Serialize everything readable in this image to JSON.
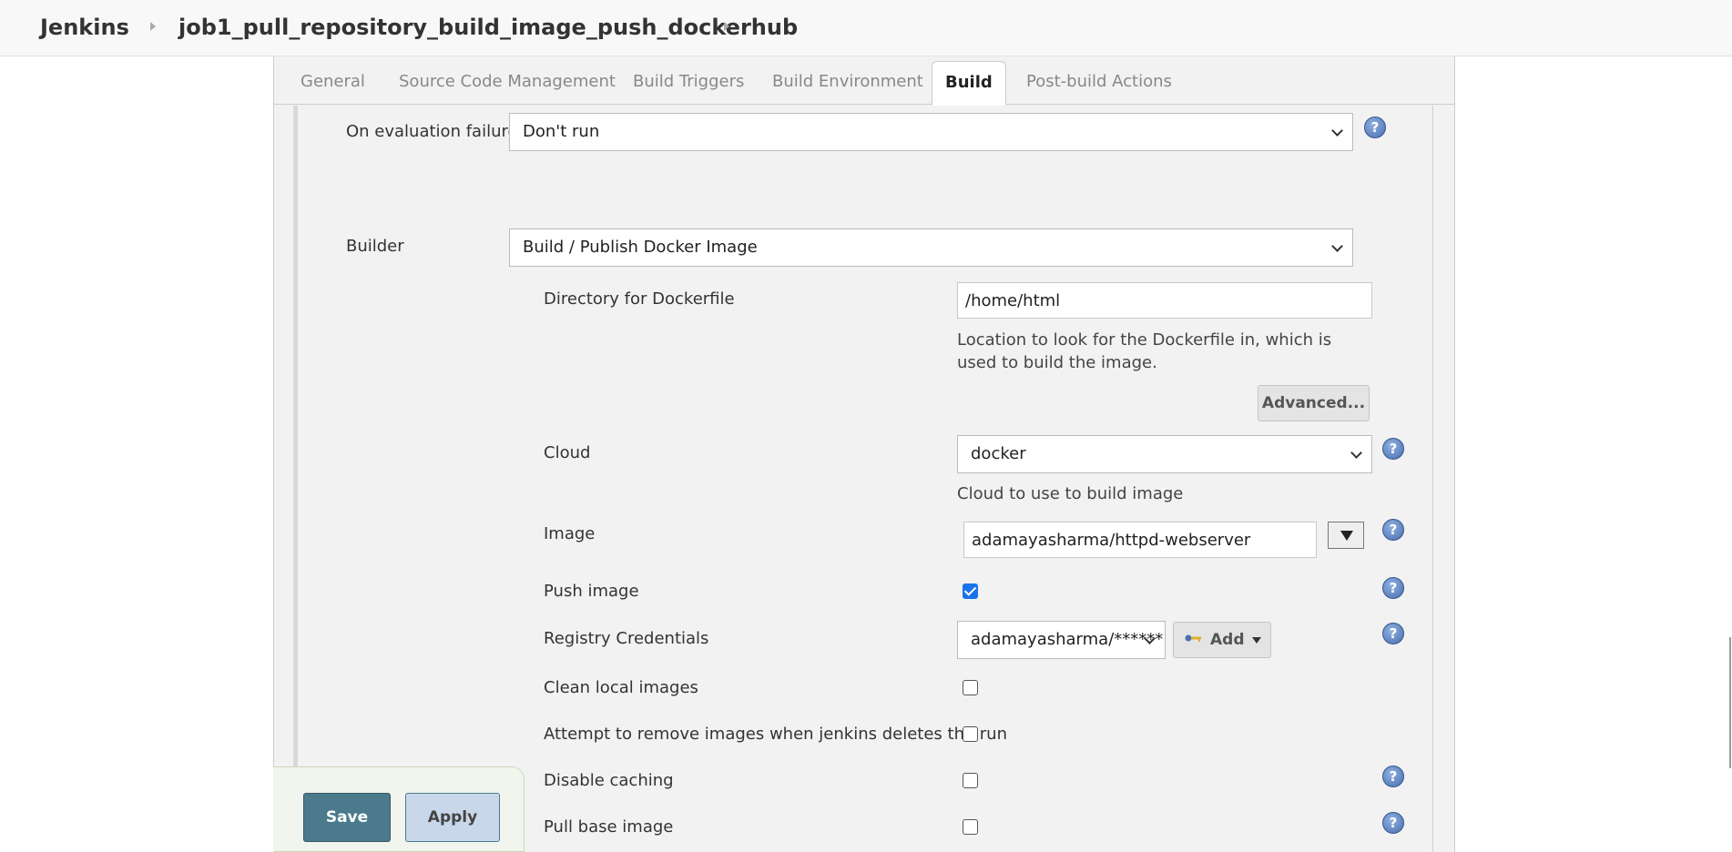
{
  "breadcrumb": {
    "root": "Jenkins",
    "job": "job1_pull_repository_build_image_push_dockerhub"
  },
  "tabs": [
    {
      "label": "General"
    },
    {
      "label": "Source Code Management"
    },
    {
      "label": "Build Triggers"
    },
    {
      "label": "Build Environment"
    },
    {
      "label": "Build"
    },
    {
      "label": "Post-build Actions"
    }
  ],
  "active_tab": "Build",
  "form": {
    "on_eval_failure": {
      "label": "On evaluation failure",
      "value": "Don't run"
    },
    "builder": {
      "label": "Builder",
      "value": "Build / Publish Docker Image"
    },
    "dockerfile_dir": {
      "label": "Directory for Dockerfile",
      "value": "/home/html",
      "description": "Location to look for the Dockerfile in, which is used to build the image."
    },
    "advanced_label": "Advanced...",
    "cloud": {
      "label": "Cloud",
      "value": "docker",
      "description": "Cloud to use to build image"
    },
    "image": {
      "label": "Image",
      "value": "adamayasharma/httpd-webserver"
    },
    "push_image": {
      "label": "Push image",
      "checked": true
    },
    "registry_credentials": {
      "label": "Registry Credentials",
      "value": "adamayasharma/******",
      "add_label": "Add"
    },
    "clean_local_images": {
      "label": "Clean local images",
      "checked": false
    },
    "remove_images": {
      "label": "Attempt to remove images when jenkins deletes the run",
      "checked": false
    },
    "disable_caching": {
      "label": "Disable caching",
      "checked": false
    },
    "pull_base_image": {
      "label": "Pull base image",
      "checked": false
    }
  },
  "buttons": {
    "save": "Save",
    "apply": "Apply"
  },
  "help_glyph": "?",
  "colors": {
    "save_bg": "#4a7a8c",
    "apply_bg": "#c8d8ea",
    "checkbox_checked": "#1a73e8",
    "help_icon": "#4a6fb0"
  }
}
